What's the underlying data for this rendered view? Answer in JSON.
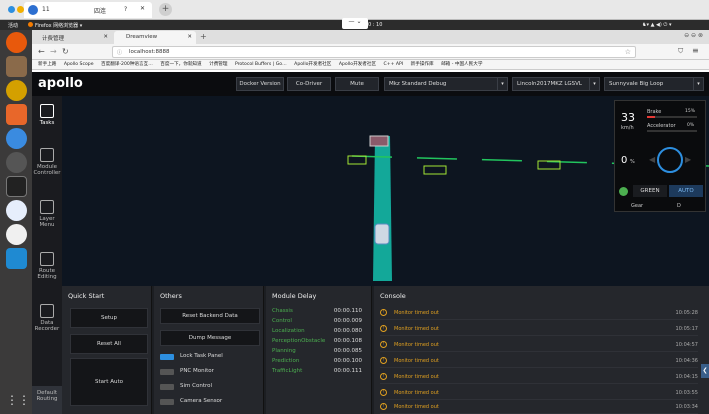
{
  "top_window": {
    "tab_title": "11",
    "search_text": "四连",
    "new_tab_symbol": "+"
  },
  "ubuntu_bar": {
    "activities": "活动",
    "app_name": "Firefox 网络浏览器 ▾",
    "clock": "0 : 10"
  },
  "browser": {
    "tabs": [
      {
        "label": "计费管理"
      },
      {
        "label": "Dreamview"
      }
    ],
    "url": "localhost:8888",
    "bookmarks": [
      "新手上路",
      "Apollo Scope",
      "百度翻译-200种语言互…",
      "百度一下，你就知道",
      "计费管理",
      "Protocol Buffers | Go…",
      "Apollo开发者社区",
      "Apollo开发者社区",
      "C++ API",
      "新手操作库",
      "邮箱 - 中国人民大学"
    ]
  },
  "header": {
    "logo": "apollo",
    "buttons": {
      "docker": "Docker Version",
      "codriver": "Co-Driver",
      "mute": "Mute"
    },
    "mode": "Mkz Standard Debug",
    "vehicle": "Lincoln2017MKZ LGSVL",
    "map": "Sunnyvale Big Loop"
  },
  "sidebar": [
    {
      "label": "Tasks",
      "icon": "tasks-icon"
    },
    {
      "label": "Module Controller",
      "icon": "module-controller-icon"
    },
    {
      "label": "Layer Menu",
      "icon": "layer-menu-icon"
    },
    {
      "label": "Route Editing",
      "icon": "route-editing-icon"
    },
    {
      "label": "Data Recorder",
      "icon": "data-recorder-icon"
    },
    {
      "label": "Default Routing",
      "icon": "default-routing-icon"
    }
  ],
  "dashboard": {
    "speed": "33",
    "speed_unit": "km/h",
    "brake_label": "Brake",
    "brake_value": "15%",
    "accel_label": "Accelerator",
    "accel_value": "0%",
    "steer_angle": "0",
    "steer_unit": "%",
    "signal": "GREEN",
    "drive_mode": "AUTO",
    "gear_label": "Gear",
    "gear_value": "D",
    "brake_fraction": 0.15,
    "accel_fraction": 0.0,
    "colors": {
      "signal": "#4caf50",
      "mode": "#2d8fe0",
      "trajectory": "#22c55e"
    }
  },
  "quick_start": {
    "title": "Quick Start",
    "setup": "Setup",
    "reset_all": "Reset All",
    "start_auto": "Start Auto"
  },
  "others": {
    "title": "Others",
    "reset_backend": "Reset Backend Data",
    "dump_message": "Dump Message",
    "toggles": [
      {
        "label": "Lock Task Panel",
        "on": true
      },
      {
        "label": "PNC Monitor",
        "on": false
      },
      {
        "label": "Sim Control",
        "on": false
      },
      {
        "label": "Camera Sensor",
        "on": false
      }
    ]
  },
  "module_delay": {
    "title": "Module Delay",
    "rows": [
      {
        "name": "Chassis",
        "value": "00:00.110"
      },
      {
        "name": "Control",
        "value": "00:00.009"
      },
      {
        "name": "Localization",
        "value": "00:00.080"
      },
      {
        "name": "PerceptionObstacle",
        "value": "00:00.108"
      },
      {
        "name": "Planning",
        "value": "00:00.085"
      },
      {
        "name": "Prediction",
        "value": "00:00.100"
      },
      {
        "name": "TrafficLight",
        "value": "00:00.111"
      }
    ]
  },
  "console": {
    "title": "Console",
    "rows": [
      {
        "text": "Monitor timed out",
        "time": "10:05:28"
      },
      {
        "text": "Monitor timed out",
        "time": "10:05:17"
      },
      {
        "text": "Monitor timed out",
        "time": "10:04:57"
      },
      {
        "text": "Monitor timed out",
        "time": "10:04:36"
      },
      {
        "text": "Monitor timed out",
        "time": "10:04:15"
      },
      {
        "text": "Monitor timed out",
        "time": "10:03:55"
      },
      {
        "text": "Monitor timed out",
        "time": "10:03:34"
      }
    ]
  }
}
